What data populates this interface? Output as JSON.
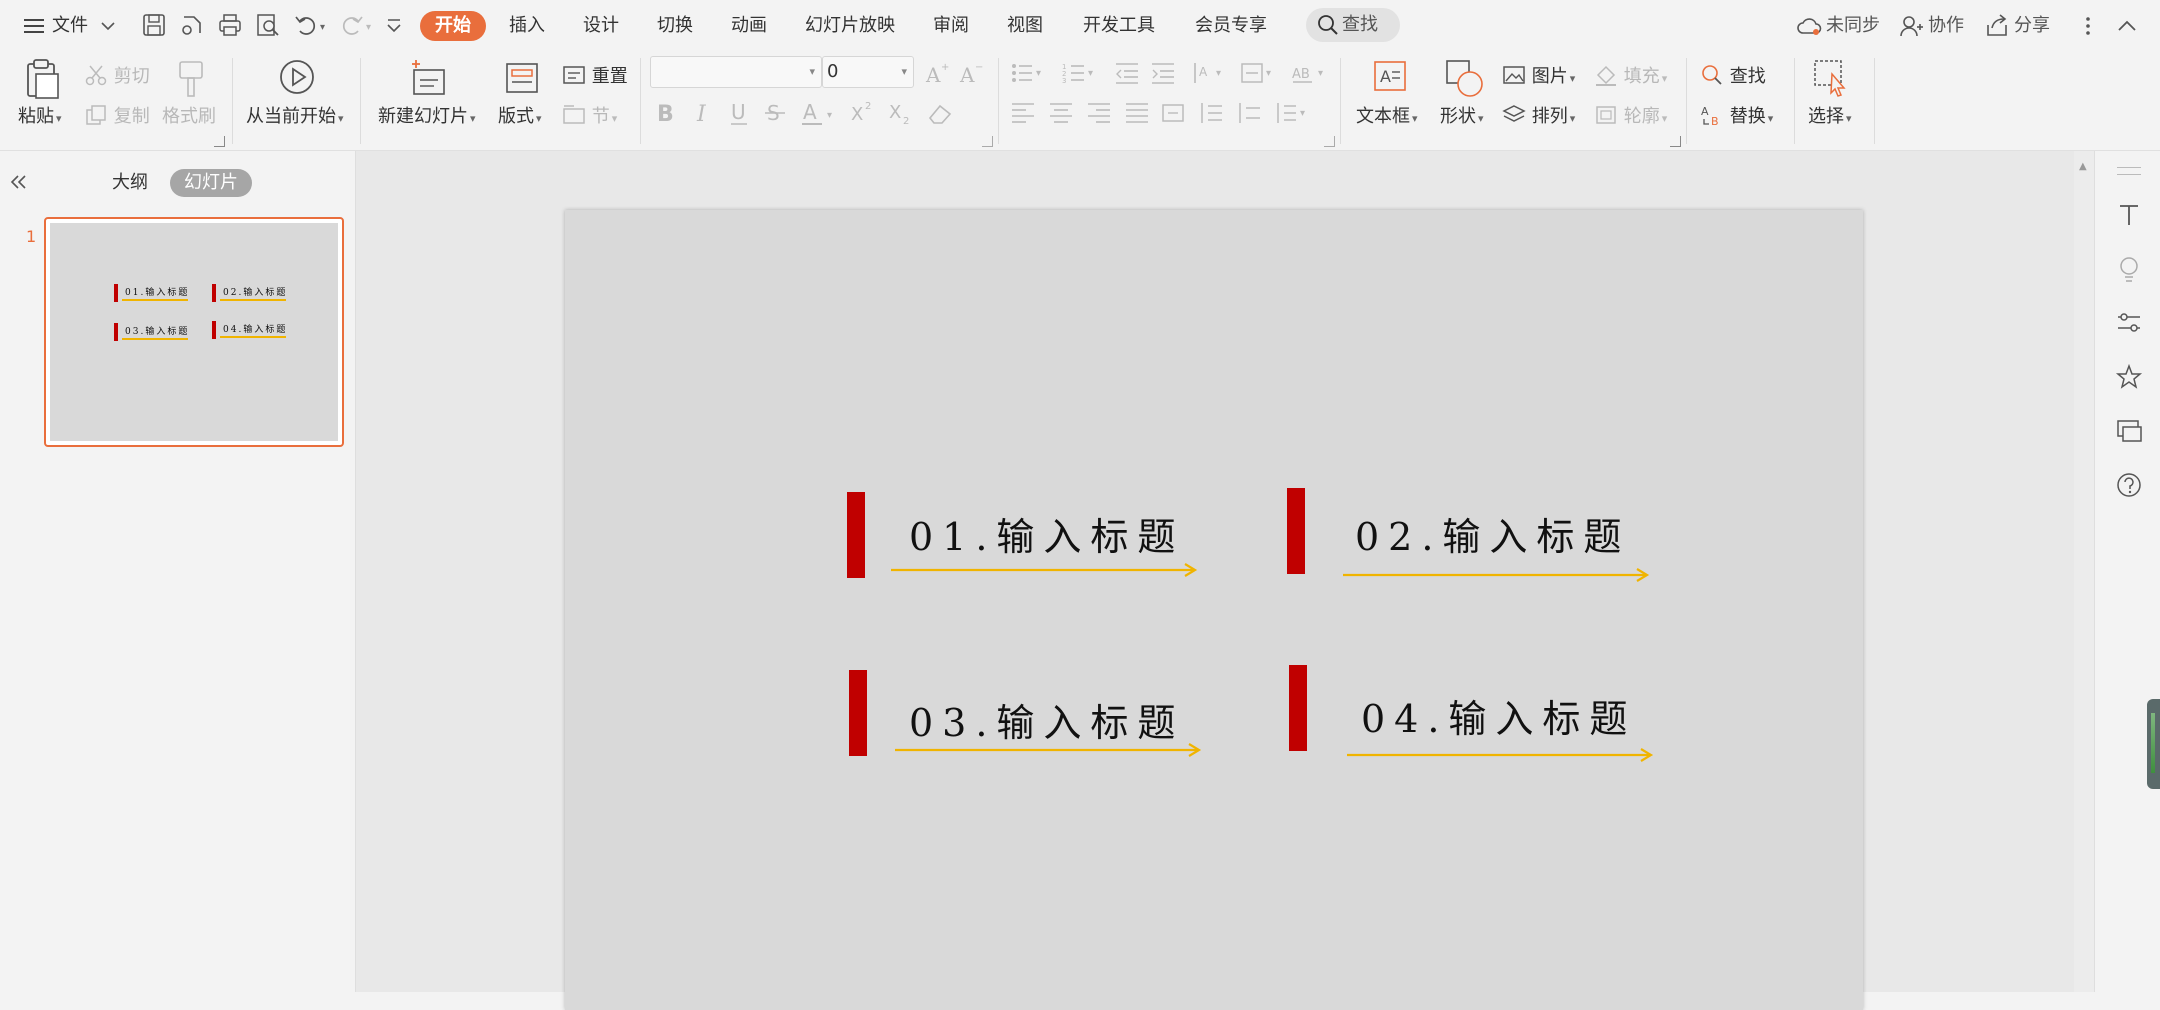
{
  "menubar": {
    "file_label": "文件",
    "tabs": [
      "开始",
      "插入",
      "设计",
      "切换",
      "动画",
      "幻灯片放映",
      "审阅",
      "视图",
      "开发工具",
      "会员专享"
    ],
    "active_tab": "开始",
    "search_label": "查找",
    "sync_label": "未同步",
    "collab_label": "协作",
    "share_label": "分享"
  },
  "ribbon": {
    "paste": "粘贴",
    "cut": "剪切",
    "copy": "复制",
    "format_painter": "格式刷",
    "from_current": "从当前开始",
    "new_slide": "新建幻灯片",
    "layout": "版式",
    "reset": "重置",
    "section": "节",
    "font_size_value": "0",
    "textbox": "文本框",
    "shape": "形状",
    "picture": "图片",
    "fill": "填充",
    "arrange": "排列",
    "outline": "轮廓",
    "find": "查找",
    "replace": "替换",
    "select": "选择"
  },
  "leftpanel": {
    "tab_outline": "大纲",
    "tab_slides": "幻灯片",
    "slide_number": "1"
  },
  "slide": {
    "items": [
      {
        "title": "01.输入标题"
      },
      {
        "title": "02.输入标题"
      },
      {
        "title": "03.输入标题"
      },
      {
        "title": "04.输入标题"
      }
    ]
  },
  "colors": {
    "accent": "#e96e3c",
    "red_bar": "#c00000",
    "arrow": "#f0b400",
    "slide_bg": "#d9d9d9"
  }
}
